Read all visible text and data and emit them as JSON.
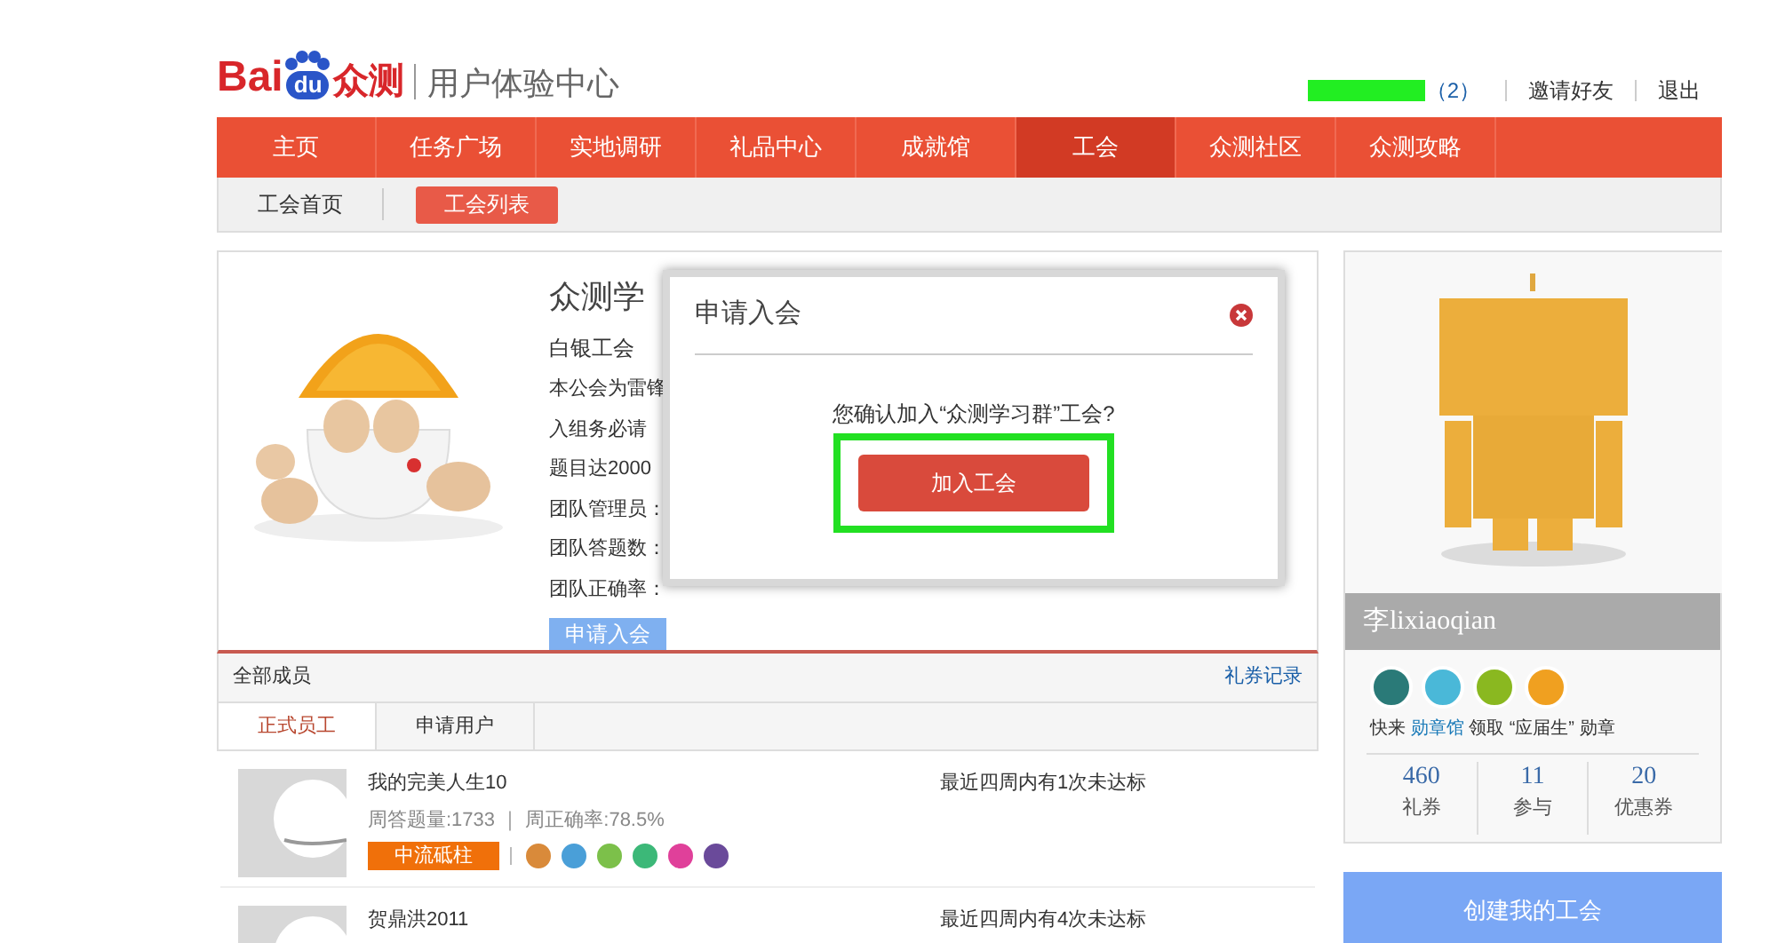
{
  "header": {
    "logo": {
      "left": "Bai",
      "middle": "du",
      "right": "众测"
    },
    "site_title": "用户体验中心",
    "user": {
      "message_count": "（2）"
    },
    "links": [
      "邀请好友",
      "退出"
    ]
  },
  "nav": [
    {
      "label": "主页",
      "selected": false
    },
    {
      "label": "任务广场",
      "selected": false
    },
    {
      "label": "实地调研",
      "selected": false
    },
    {
      "label": "礼品中心",
      "selected": false
    },
    {
      "label": "成就馆",
      "selected": false
    },
    {
      "label": "工会",
      "selected": true
    },
    {
      "label": "众测社区",
      "selected": false
    },
    {
      "label": "众测攻略",
      "selected": false
    }
  ],
  "subnav": [
    {
      "label": "工会首页",
      "selected": false
    },
    {
      "label": "工会列表",
      "selected": true
    }
  ],
  "guild": {
    "name": "众测学",
    "level": "白银工会",
    "lines": [
      "本公会为雷锋",
      "入组务必请",
      "题目达2000",
      "团队管理员：",
      "团队答题数：",
      "团队正确率："
    ],
    "apply_button": "申请入会"
  },
  "dialog": {
    "title": "申请入会",
    "message": "您确认加入“众测学习群”工会?",
    "confirm_button": "加入工会"
  },
  "members": {
    "title": "全部成员",
    "link": "礼券记录",
    "tabs": [
      {
        "label": "正式员工",
        "selected": true
      },
      {
        "label": "申请用户",
        "selected": false
      }
    ],
    "rows": [
      {
        "name": "我的完美人生10",
        "stats": "周答题量:1733 ｜ 周正确率:78.5%",
        "rank": "中流砥柱",
        "badges": [
          {
            "color": "#d98a3a"
          },
          {
            "color": "#4a9fd8"
          },
          {
            "color": "#7cc04a"
          },
          {
            "color": "#3cb878"
          },
          {
            "color": "#e0409a"
          },
          {
            "color": "#6a4a9a"
          }
        ],
        "status": "最近四周内有1次未达标"
      },
      {
        "name": "贺鼎洪2011",
        "status": "最近四周内有4次未达标"
      }
    ]
  },
  "profile": {
    "name": "李lixiaoqian",
    "badges": [
      {
        "color": "#2a7a78"
      },
      {
        "color": "#4ab8d8"
      },
      {
        "color": "#8ab820"
      },
      {
        "color": "#f0a020"
      }
    ],
    "hint_before": "快来",
    "hint_link": "勋章馆",
    "hint_after": "领取 “应届生” 勋章",
    "stats": [
      {
        "value": "460",
        "label": "礼券"
      },
      {
        "value": "11",
        "label": "参与"
      },
      {
        "value": "20",
        "label": "优惠券"
      }
    ],
    "create_button": "创建我的工会"
  }
}
